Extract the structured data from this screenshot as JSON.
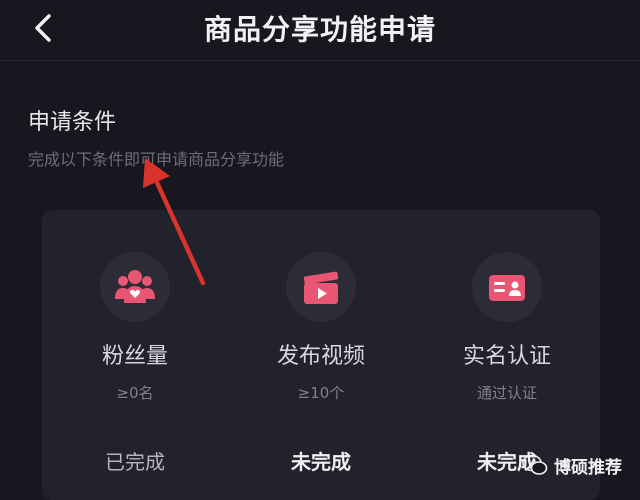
{
  "header": {
    "title": "商品分享功能申请",
    "back_icon": "chevron-left-icon"
  },
  "conditions": {
    "title": "申请条件",
    "subtitle": "完成以下条件即可申请商品分享功能"
  },
  "requirements": [
    {
      "icon": "fans-icon",
      "label": "粉丝量",
      "requirement": "≥0名",
      "status": "已完成"
    },
    {
      "icon": "video-icon",
      "label": "发布视频",
      "requirement": "≥10个",
      "status": "未完成"
    },
    {
      "icon": "id-card-icon",
      "label": "实名认证",
      "requirement": "通过认证",
      "status": "未完成"
    }
  ],
  "watermark": {
    "text": "博硕推荐",
    "icon": "wechat-icon"
  },
  "colors": {
    "background": "#17171f",
    "card": "#22222c",
    "accent": "#e85673",
    "arrow": "#d9342b"
  }
}
